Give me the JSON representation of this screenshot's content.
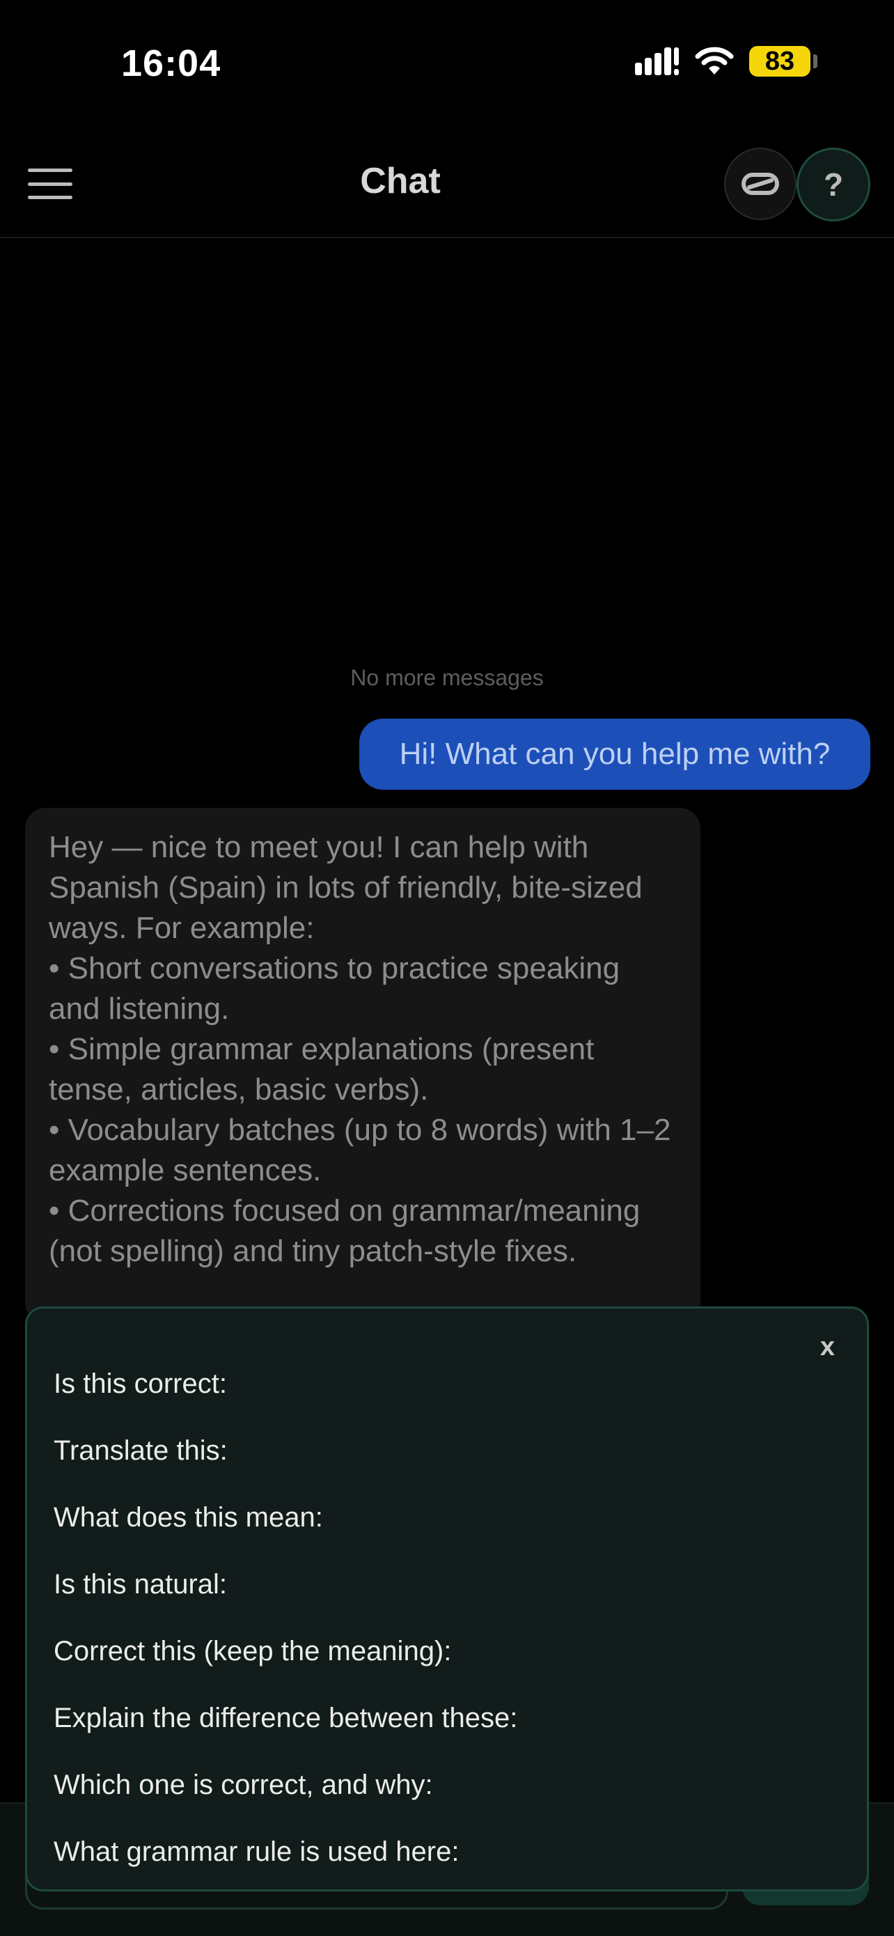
{
  "status_bar": {
    "time": "16:04",
    "battery": "83"
  },
  "header": {
    "title": "Chat",
    "help_label": "?"
  },
  "chat": {
    "no_more": "No more messages",
    "user_message": "Hi! What can you help me with?",
    "bot_message_lines": [
      "Hey — nice to meet you! I can help with Spanish (Spain) in lots of friendly, bite-sized ways. For example:",
      "• Short conversations to practice speaking and listening.",
      "• Simple grammar explanations (present tense, articles, basic verbs).",
      "• Vocabulary batches (up to 8 words) with 1–2 example sentences.",
      "• Corrections focused on grammar/meaning (not spelling) and tiny patch-style fixes."
    ]
  },
  "popup": {
    "close_label": "x",
    "suggestions": [
      "Is this correct:",
      "Translate this:",
      "What does this mean:",
      "Is this natural:",
      "Correct this (keep the meaning):",
      "Explain the difference between these:",
      "Which one is correct, and why:",
      "What grammar rule is used here:"
    ]
  },
  "colors": {
    "background": "#000000",
    "user_bubble": "#1d4fb8",
    "bot_bubble": "#161616",
    "popup_bg": "#111c1b",
    "popup_border": "#1e4a40",
    "battery": "#f5d60a"
  },
  "icons": {
    "menu": "hamburger-icon",
    "glasses": "glasses-icon",
    "signal": "signal-icon",
    "wifi": "wifi-icon",
    "battery": "battery-icon"
  }
}
